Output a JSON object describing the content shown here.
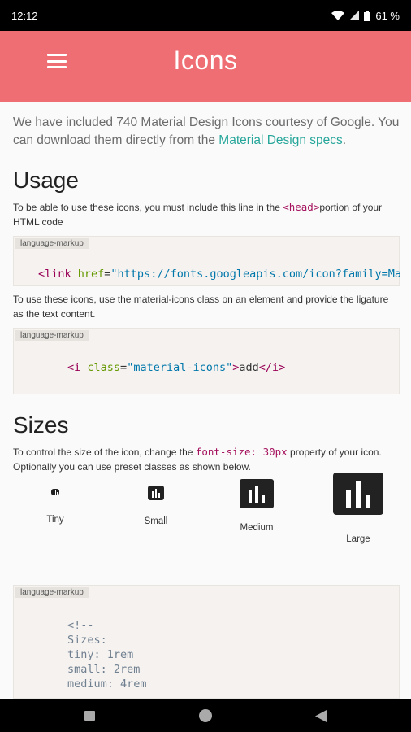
{
  "status_bar": {
    "time": "12:12",
    "battery": "61 %"
  },
  "app_bar": {
    "title": "Icons"
  },
  "intro": {
    "text": "We have included 740 Material Design Icons courtesy of Google. You can download them directly from the ",
    "link_text": "Material Design specs",
    "end": "."
  },
  "usage": {
    "heading": "Usage",
    "p1_a": "To be able to use these icons, you must include this line in the ",
    "p1_code": "<head>",
    "p1_b": "portion of your HTML code",
    "code1_label": "language-markup",
    "code1_tag_open": "<link",
    "code1_attr": " href",
    "code1_eq": "=",
    "code1_val": "\"https://fonts.googleapis.com/icon?family=Material+Icons\"",
    "p2": "To use these icons, use the material-icons class on an element and provide the ligature as the text content.",
    "code2_label": "language-markup",
    "code2_tag_open": "<i",
    "code2_attr": " class",
    "code2_eq": "=",
    "code2_val": "\"material-icons\"",
    "code2_close_gt": ">",
    "code2_text": "add",
    "code2_tag_close": "</i",
    "code2_end": ">"
  },
  "sizes": {
    "heading": "Sizes",
    "p_a": "To control the size of the icon, change the ",
    "p_code": "font-size: 30px",
    "p_b": " property of your icon. Optionally you can use preset classes as shown below.",
    "items": [
      {
        "label": "Tiny",
        "icon": "insert-chart-icon"
      },
      {
        "label": "Small",
        "icon": "insert-chart-icon"
      },
      {
        "label": "Medium",
        "icon": "insert-chart-icon"
      },
      {
        "label": "Large",
        "icon": "insert-chart-icon"
      }
    ],
    "code3_label": "language-markup",
    "code3_lines": [
      "<!--",
      "Sizes:",
      "tiny: 1rem",
      "small: 2rem",
      "medium: 4rem"
    ]
  },
  "colors": {
    "app_bar": "#ee6e73",
    "link": "#26a69a",
    "status_bar": "#000000",
    "nav_bar": "#000000"
  }
}
